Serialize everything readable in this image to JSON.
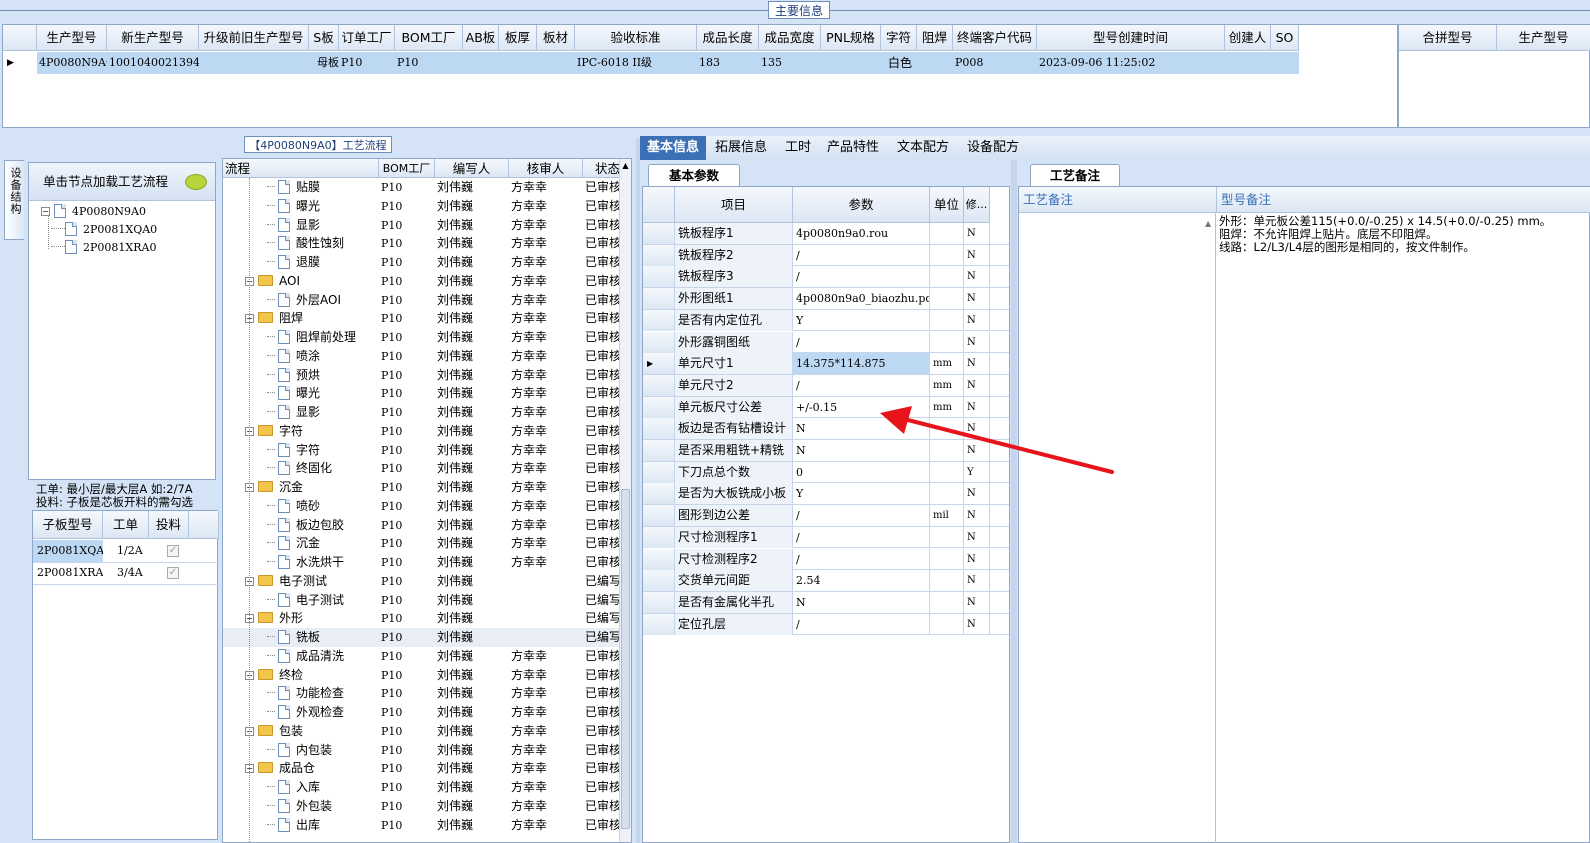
{
  "top": {
    "group_label": "主要信息",
    "columns": [
      "生产型号",
      "新生产型号",
      "升级前旧生产型号",
      "S板",
      "订单工厂",
      "BOM工厂",
      "AB板",
      "板厚",
      "板材",
      "验收标准",
      "成品长度",
      "成品宽度",
      "PNL规格",
      "字符",
      "阻焊",
      "终端客户代码",
      "型号创建时间",
      "创建人",
      "SO"
    ],
    "row": [
      "4P0080N9A0",
      "10010400213940",
      "",
      "母板",
      "P10",
      "P10",
      "",
      "",
      "",
      "IPC-6018 II级",
      "183",
      "135",
      "",
      "白色",
      "",
      "P008",
      "2023-09-06 11:25:02",
      "",
      ""
    ],
    "right_columns": [
      "合拼型号",
      "生产型号"
    ]
  },
  "flow_panel": {
    "title": "【4P0080N9A0】工艺流程",
    "side_tab": "设备结构",
    "load_hint": "单击节点加载工艺流程",
    "tree": {
      "root": "4P0080N9A0",
      "children": [
        "2P0081XQA0",
        "2P0081XRA0"
      ]
    },
    "note_line1": "工单: 最小层/最大层A 如:2/7A",
    "note_line2": "投料: 子板是芯板开料的需勾选",
    "sub_columns": [
      "子板型号",
      "工单",
      "投料"
    ],
    "sub_rows": [
      {
        "model": "2P0081XQA0",
        "order": "1/2A"
      },
      {
        "model": "2P0081XRA0",
        "order": "3/4A"
      }
    ],
    "flow_columns": [
      "流程",
      "BOM工厂",
      "编写人",
      "核审人",
      "状态"
    ],
    "flow_rows": [
      {
        "kind": "item",
        "name": "贴膜",
        "bom": "P10",
        "writer": "刘伟巍",
        "reviewer": "方幸幸",
        "status": "已审核"
      },
      {
        "kind": "item",
        "name": "曝光",
        "bom": "P10",
        "writer": "刘伟巍",
        "reviewer": "方幸幸",
        "status": "已审核"
      },
      {
        "kind": "item",
        "name": "显影",
        "bom": "P10",
        "writer": "刘伟巍",
        "reviewer": "方幸幸",
        "status": "已审核"
      },
      {
        "kind": "item",
        "name": "酸性蚀刻",
        "bom": "P10",
        "writer": "刘伟巍",
        "reviewer": "方幸幸",
        "status": "已审核"
      },
      {
        "kind": "item",
        "name": "退膜",
        "bom": "P10",
        "writer": "刘伟巍",
        "reviewer": "方幸幸",
        "status": "已审核"
      },
      {
        "kind": "group",
        "name": "AOI",
        "bom": "P10",
        "writer": "刘伟巍",
        "reviewer": "方幸幸",
        "status": "已审核"
      },
      {
        "kind": "item",
        "name": "外层AOI",
        "bom": "P10",
        "writer": "刘伟巍",
        "reviewer": "方幸幸",
        "status": "已审核"
      },
      {
        "kind": "group",
        "name": "阻焊",
        "bom": "P10",
        "writer": "刘伟巍",
        "reviewer": "方幸幸",
        "status": "已审核"
      },
      {
        "kind": "item",
        "name": "阻焊前处理",
        "bom": "P10",
        "writer": "刘伟巍",
        "reviewer": "方幸幸",
        "status": "已审核"
      },
      {
        "kind": "item",
        "name": "喷涂",
        "bom": "P10",
        "writer": "刘伟巍",
        "reviewer": "方幸幸",
        "status": "已审核"
      },
      {
        "kind": "item",
        "name": "预烘",
        "bom": "P10",
        "writer": "刘伟巍",
        "reviewer": "方幸幸",
        "status": "已审核"
      },
      {
        "kind": "item",
        "name": "曝光",
        "bom": "P10",
        "writer": "刘伟巍",
        "reviewer": "方幸幸",
        "status": "已审核"
      },
      {
        "kind": "item",
        "name": "显影",
        "bom": "P10",
        "writer": "刘伟巍",
        "reviewer": "方幸幸",
        "status": "已审核"
      },
      {
        "kind": "group",
        "name": "字符",
        "bom": "P10",
        "writer": "刘伟巍",
        "reviewer": "方幸幸",
        "status": "已审核"
      },
      {
        "kind": "item",
        "name": "字符",
        "bom": "P10",
        "writer": "刘伟巍",
        "reviewer": "方幸幸",
        "status": "已审核"
      },
      {
        "kind": "item",
        "name": "终固化",
        "bom": "P10",
        "writer": "刘伟巍",
        "reviewer": "方幸幸",
        "status": "已审核"
      },
      {
        "kind": "group",
        "name": "沉金",
        "bom": "P10",
        "writer": "刘伟巍",
        "reviewer": "方幸幸",
        "status": "已审核"
      },
      {
        "kind": "item",
        "name": "喷砂",
        "bom": "P10",
        "writer": "刘伟巍",
        "reviewer": "方幸幸",
        "status": "已审核"
      },
      {
        "kind": "item",
        "name": "板边包胶",
        "bom": "P10",
        "writer": "刘伟巍",
        "reviewer": "方幸幸",
        "status": "已审核"
      },
      {
        "kind": "item",
        "name": "沉金",
        "bom": "P10",
        "writer": "刘伟巍",
        "reviewer": "方幸幸",
        "status": "已审核"
      },
      {
        "kind": "item",
        "name": "水洗烘干",
        "bom": "P10",
        "writer": "刘伟巍",
        "reviewer": "方幸幸",
        "status": "已审核"
      },
      {
        "kind": "group",
        "name": "电子测试",
        "bom": "P10",
        "writer": "刘伟巍",
        "reviewer": "",
        "status": "已编写"
      },
      {
        "kind": "item",
        "name": "电子测试",
        "bom": "P10",
        "writer": "刘伟巍",
        "reviewer": "",
        "status": "已编写"
      },
      {
        "kind": "group",
        "name": "外形",
        "bom": "P10",
        "writer": "刘伟巍",
        "reviewer": "",
        "status": "已编写"
      },
      {
        "kind": "item",
        "name": "铣板",
        "bom": "P10",
        "writer": "刘伟巍",
        "reviewer": "",
        "status": "已编写",
        "selected": true
      },
      {
        "kind": "item",
        "name": "成品清洗",
        "bom": "P10",
        "writer": "刘伟巍",
        "reviewer": "方幸幸",
        "status": "已审核"
      },
      {
        "kind": "group",
        "name": "终检",
        "bom": "P10",
        "writer": "刘伟巍",
        "reviewer": "方幸幸",
        "status": "已审核"
      },
      {
        "kind": "item",
        "name": "功能检查",
        "bom": "P10",
        "writer": "刘伟巍",
        "reviewer": "方幸幸",
        "status": "已审核"
      },
      {
        "kind": "item",
        "name": "外观检查",
        "bom": "P10",
        "writer": "刘伟巍",
        "reviewer": "方幸幸",
        "status": "已审核"
      },
      {
        "kind": "group",
        "name": "包装",
        "bom": "P10",
        "writer": "刘伟巍",
        "reviewer": "方幸幸",
        "status": "已审核"
      },
      {
        "kind": "item",
        "name": "内包装",
        "bom": "P10",
        "writer": "刘伟巍",
        "reviewer": "方幸幸",
        "status": "已审核"
      },
      {
        "kind": "group",
        "name": "成品仓",
        "bom": "P10",
        "writer": "刘伟巍",
        "reviewer": "方幸幸",
        "status": "已审核"
      },
      {
        "kind": "item",
        "name": "入库",
        "bom": "P10",
        "writer": "刘伟巍",
        "reviewer": "方幸幸",
        "status": "已审核"
      },
      {
        "kind": "item",
        "name": "外包装",
        "bom": "P10",
        "writer": "刘伟巍",
        "reviewer": "方幸幸",
        "status": "已审核"
      },
      {
        "kind": "item",
        "name": "出库",
        "bom": "P10",
        "writer": "刘伟巍",
        "reviewer": "方幸幸",
        "status": "已审核"
      }
    ]
  },
  "detail": {
    "tabs": [
      "基本信息",
      "拓展信息",
      "工时",
      "产品特性",
      "文本配方",
      "设备配方"
    ],
    "subtab": "基本参数",
    "param_columns": [
      "项目",
      "参数",
      "单位",
      "修..."
    ],
    "params": [
      {
        "item": "铣板程序1",
        "value": "4p0080n9a0.rou",
        "unit": "",
        "mod": "N"
      },
      {
        "item": "铣板程序2",
        "value": "/",
        "unit": "",
        "mod": "N"
      },
      {
        "item": "铣板程序3",
        "value": "/",
        "unit": "",
        "mod": "N"
      },
      {
        "item": "外形图纸1",
        "value": "4p0080n9a0_biaozhu.pdf",
        "unit": "",
        "mod": "N"
      },
      {
        "item": "是否有内定位孔",
        "value": "Y",
        "unit": "",
        "mod": "N"
      },
      {
        "item": "外形露铜图纸",
        "value": "/",
        "unit": "",
        "mod": "N"
      },
      {
        "item": "单元尺寸1",
        "value": "14.375*114.875",
        "unit": "mm",
        "mod": "N",
        "selected": true
      },
      {
        "item": "单元尺寸2",
        "value": "/",
        "unit": "mm",
        "mod": "N"
      },
      {
        "item": "单元板尺寸公差",
        "value": "+/-0.15",
        "unit": "mm",
        "mod": "N"
      },
      {
        "item": "板边是否有钻槽设计",
        "value": "N",
        "unit": "",
        "mod": "N"
      },
      {
        "item": "是否采用粗铣+精铣",
        "value": "N",
        "unit": "",
        "mod": "N"
      },
      {
        "item": "下刀点总个数",
        "value": "0",
        "unit": "",
        "mod": "Y"
      },
      {
        "item": "是否为大板铣成小板",
        "value": "Y",
        "unit": "",
        "mod": "N"
      },
      {
        "item": "图形到边公差",
        "value": "/",
        "unit": "mil",
        "mod": "N"
      },
      {
        "item": "尺寸检测程序1",
        "value": "/",
        "unit": "",
        "mod": "N"
      },
      {
        "item": "尺寸检测程序2",
        "value": "/",
        "unit": "",
        "mod": "N"
      },
      {
        "item": "交货单元间距",
        "value": "2.54",
        "unit": "",
        "mod": "N"
      },
      {
        "item": "是否有金属化半孔",
        "value": "N",
        "unit": "",
        "mod": "N"
      },
      {
        "item": "定位孔层",
        "value": "/",
        "unit": "",
        "mod": "N"
      }
    ]
  },
  "remarks": {
    "tab": "工艺备注",
    "col1": "工艺备注",
    "col2": "型号备注",
    "lines": [
      "外形：单元板公差115(+0.0/-0.25) x 14.5(+0.0/-0.25) mm。",
      "阻焊：不允许阻焊上贴片。底层不印阻焊。",
      "线路：L2/L3/L4层的图形是相同的，按文件制作。"
    ]
  },
  "colors": {
    "accent": "#3b6fb6",
    "selected": "#bcd8f3",
    "arrow": "#e8141b"
  }
}
